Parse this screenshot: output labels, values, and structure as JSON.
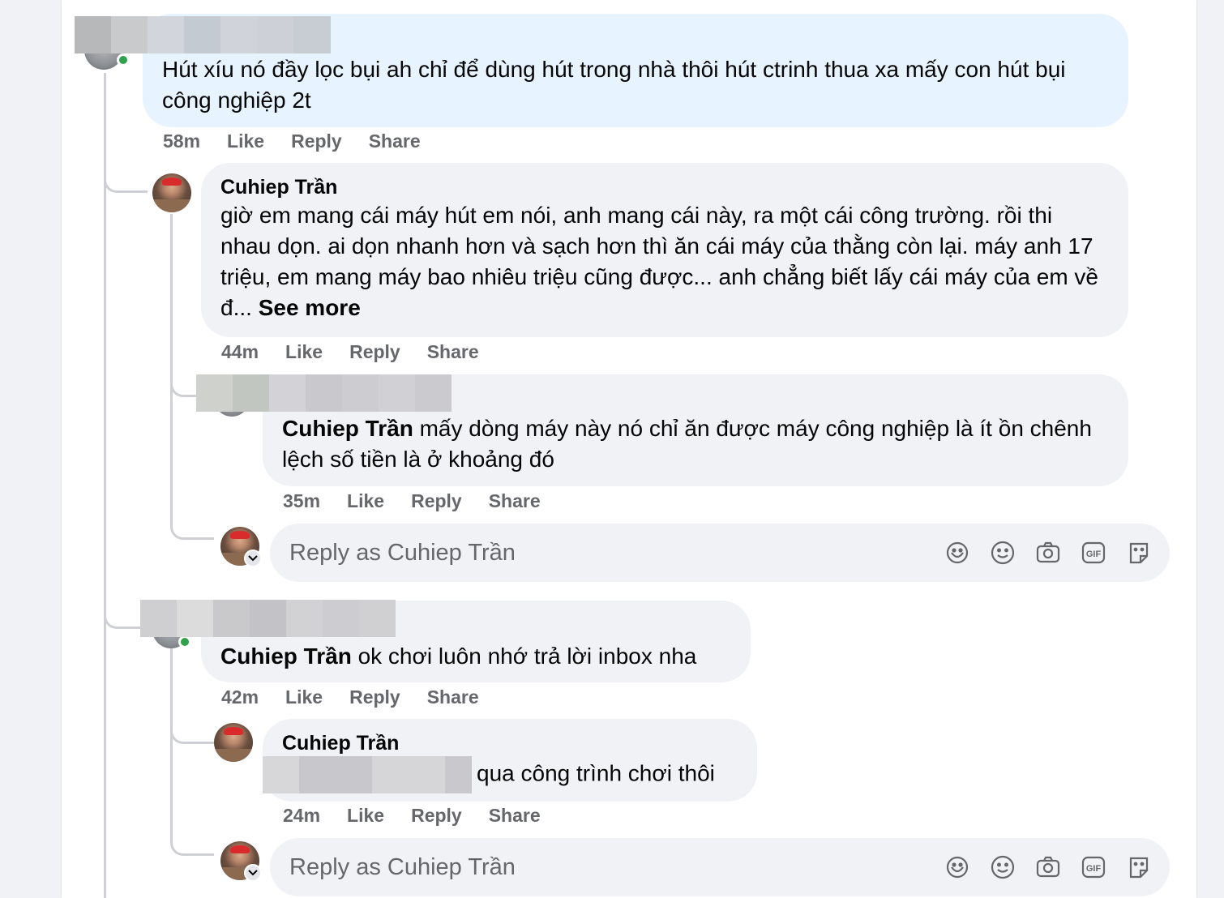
{
  "comments": [
    {
      "text": "Hút xíu nó đầy lọc bụi ah chỉ để dùng hút trong nhà thôi hút ctrinh thua xa mấy con hút bụi công nghiệp 2t",
      "actions": {
        "time": "58m",
        "like": "Like",
        "reply": "Reply",
        "share": "Share"
      }
    },
    {
      "author": "Cuhiep Trần",
      "text": "giờ em mang cái máy hút em nói, anh mang cái này, ra một cái công trường. rồi thi nhau dọn. ai dọn nhanh hơn và sạch hơn thì ăn cái máy của thằng còn lại. máy anh 17 triệu, em mang máy bao nhiêu triệu cũng được... anh chẳng biết lấy cái máy của em về đ...",
      "see_more": "See more",
      "actions": {
        "time": "44m",
        "like": "Like",
        "reply": "Reply",
        "share": "Share"
      }
    },
    {
      "mention": "Cuhiep Trần",
      "text": " mấy dòng máy này nó chỉ ăn được máy công nghiệp là ít ồn chênh lệch số tiền là ở khoảng đó",
      "actions": {
        "time": "35m",
        "like": "Like",
        "reply": "Reply",
        "share": "Share"
      }
    },
    {
      "mention": "Cuhiep Trần",
      "text": " ok chơi luôn nhớ trả lời inbox nha",
      "actions": {
        "time": "42m",
        "like": "Like",
        "reply": "Reply",
        "share": "Share"
      }
    },
    {
      "author": "Cuhiep Trần",
      "text": "qua công trình chơi thôi",
      "actions": {
        "time": "24m",
        "like": "Like",
        "reply": "Reply",
        "share": "Share"
      }
    }
  ],
  "reply_box": {
    "placeholder": "Reply as Cuhiep Trần",
    "icons": [
      "avatar-sticker-icon",
      "emoji-icon",
      "camera-icon",
      "gif-icon",
      "sticker-icon"
    ]
  },
  "colors": {
    "bubble": "#f0f2f5",
    "highlight_bubble": "#e7f3ff",
    "secondary_text": "#65676b",
    "online": "#31a24c",
    "thread_line": "#ced0d4"
  }
}
